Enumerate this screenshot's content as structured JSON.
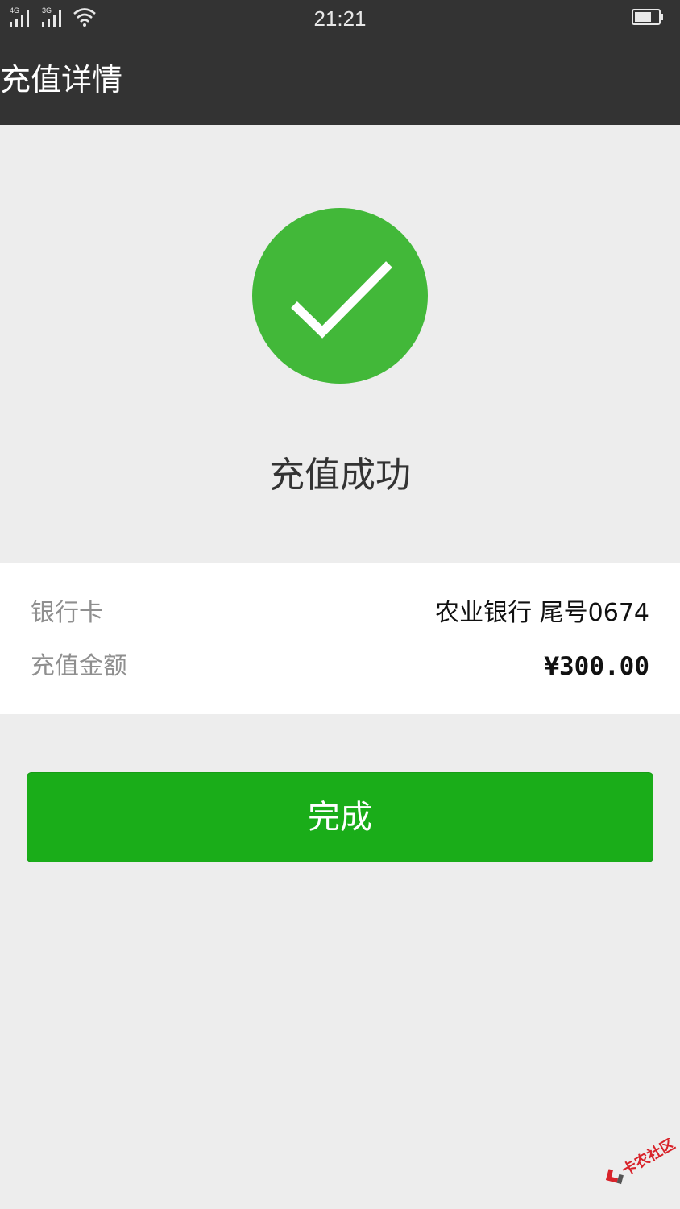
{
  "status_bar": {
    "sim1_tag": "4G",
    "sim2_tag": "3G",
    "time": "21:21"
  },
  "header": {
    "title": "充值详情"
  },
  "result": {
    "status_text": "充值成功",
    "icon": "check-circle-icon",
    "icon_color": "#42b839"
  },
  "details": {
    "bank_card": {
      "label": "银行卡",
      "value": "农业银行 尾号0674"
    },
    "amount": {
      "label": "充值金额",
      "value": "¥300.00"
    }
  },
  "actions": {
    "done_label": "完成",
    "button_color": "#1aad19"
  },
  "watermark": {
    "text": "卡农社区"
  }
}
